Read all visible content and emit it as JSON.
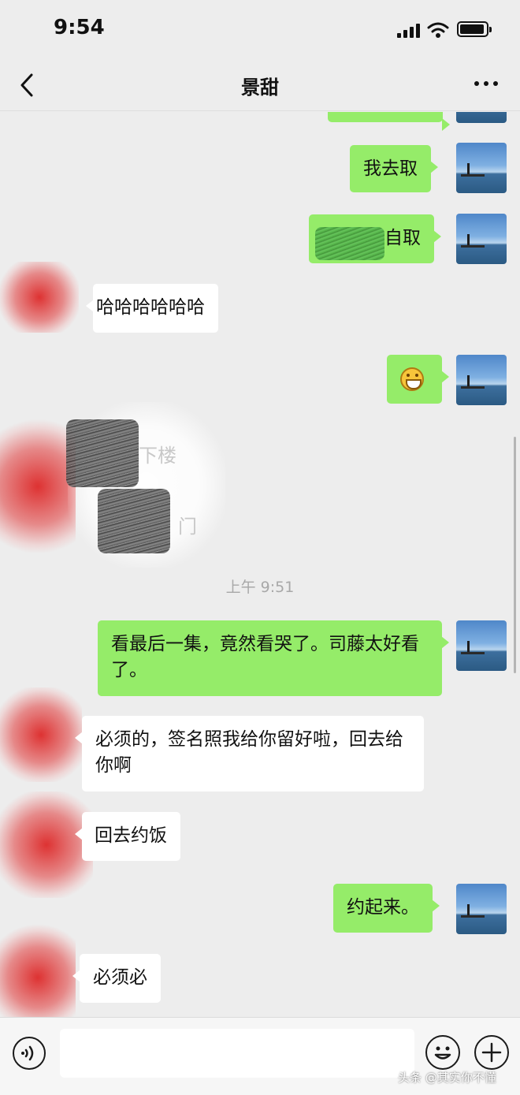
{
  "status_bar": {
    "time": "9:54"
  },
  "header": {
    "title": "景甜"
  },
  "messages": {
    "m1": "我去取",
    "m2_suffix": "自取",
    "m3": "哈哈哈哈哈哈",
    "m4_emoji": "grin-emoji",
    "m5_faded_a": "下楼",
    "m5_faded_b": "门",
    "m6": "看最后一集，竟然看哭了。司藤太好看了。",
    "m7": "必须的，签名照我给你留好啦，回去给你啊",
    "m8": "回去约饭",
    "m9": "约起来。",
    "m10": "必须必"
  },
  "timestamp": "上午 9:51",
  "input": {
    "placeholder": ""
  },
  "watermark": "头条 @其实你不懂",
  "colors": {
    "self_bubble": "#95ec69",
    "other_bubble": "#ffffff",
    "background": "#ededed"
  },
  "icons": [
    "back-icon",
    "more-icon",
    "voice-icon",
    "emoji-icon",
    "plus-icon",
    "signal-icon",
    "wifi-icon",
    "battery-icon"
  ]
}
